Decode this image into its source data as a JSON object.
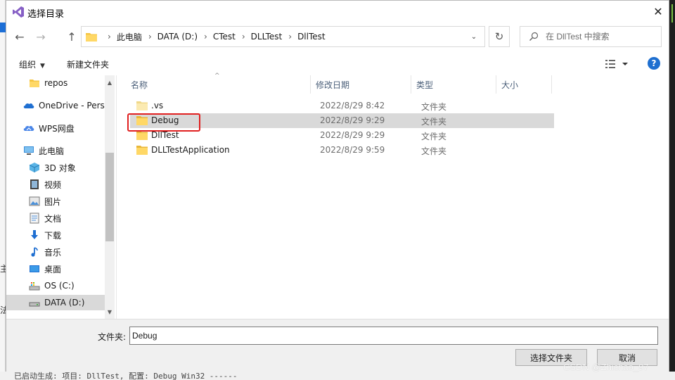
{
  "dialog": {
    "title": "选择目录",
    "close_glyph": "✕",
    "app_icon": "visual-studio-icon"
  },
  "nav": {
    "back_glyph": "←",
    "forward_glyph": "→",
    "up_glyph": "↑",
    "breadcrumbs": [
      "此电脑",
      "DATA (D:)",
      "CTest",
      "DLLTest",
      "DllTest"
    ],
    "separator": "›",
    "dropdown_glyph": "⌄",
    "refresh_glyph": "↻",
    "search_placeholder": "在 DllTest 中搜索"
  },
  "toolbar": {
    "organize_label": "组织",
    "organize_caret": "▼",
    "new_folder_label": "新建文件夹",
    "help_glyph": "?"
  },
  "sidebar": {
    "items": [
      {
        "label": "repos",
        "icon": "folder-icon"
      },
      {
        "label": "OneDrive - Perso",
        "icon": "onedrive-icon"
      },
      {
        "label": "WPS网盘",
        "icon": "wps-cloud-icon"
      },
      {
        "label": "此电脑",
        "icon": "computer-icon"
      },
      {
        "label": "3D 对象",
        "icon": "3d-objects-icon"
      },
      {
        "label": "视频",
        "icon": "video-icon"
      },
      {
        "label": "图片",
        "icon": "pictures-icon"
      },
      {
        "label": "文档",
        "icon": "documents-icon"
      },
      {
        "label": "下载",
        "icon": "download-icon"
      },
      {
        "label": "音乐",
        "icon": "music-icon"
      },
      {
        "label": "桌面",
        "icon": "desktop-icon"
      },
      {
        "label": "OS (C:)",
        "icon": "drive-c-icon"
      },
      {
        "label": "DATA (D:)",
        "icon": "drive-d-icon",
        "selected": true
      }
    ],
    "scroll_up": "▲",
    "scroll_down": "▼"
  },
  "filelist": {
    "columns": [
      "名称",
      "修改日期",
      "类型",
      "大小"
    ],
    "sort_glyph": "^",
    "rows": [
      {
        "name": ".vs",
        "date": "2022/8/29 8:42",
        "type": "文件夹",
        "icon": "folder-icon"
      },
      {
        "name": "Debug",
        "date": "2022/8/29 9:29",
        "type": "文件夹",
        "icon": "folder-icon",
        "selected": true
      },
      {
        "name": "DllTest",
        "date": "2022/8/29 9:29",
        "type": "文件夹",
        "icon": "folder-icon"
      },
      {
        "name": "DLLTestApplication",
        "date": "2022/8/29 9:59",
        "type": "文件夹",
        "icon": "folder-icon"
      }
    ]
  },
  "footer": {
    "folder_label": "文件夹:",
    "folder_value": "Debug",
    "select_button": "选择文件夹",
    "cancel_button": "取消"
  },
  "background": {
    "output_text": "已启动生成: 项目: DllTest, 配置: Debug Win32 ------",
    "left_glyph_1": "主",
    "left_glyph_2": "法"
  },
  "watermark": "CSDN @Zhichao_97",
  "colors": {
    "accent": "#1e6fd0",
    "selection": "#d9d9d9",
    "highlight_box": "#e02020",
    "folder": "#f5c542"
  }
}
